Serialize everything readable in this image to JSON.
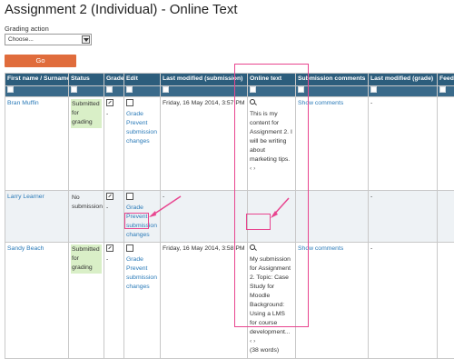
{
  "page": {
    "title": "Assignment 2 (Individual) - Online Text",
    "grading_action_label": "Grading action",
    "grading_action_value": "Choose...",
    "go_label": "Go"
  },
  "table": {
    "headers": {
      "name": "First name / Surname",
      "status": "Status",
      "grade": "Grade",
      "edit": "Edit",
      "last_modified": "Last modified (submission)",
      "online_text": "Online text",
      "comments": "Submission comments",
      "last_modified_grade": "Last modified (grade)",
      "feedback": "Feedb"
    },
    "rows": [
      {
        "name": "Bran Muffin",
        "status": "Submitted for grading",
        "grade_dash": "-",
        "edit_grade": "Grade",
        "edit_prevent": "Prevent submission changes",
        "modified": "Friday, 16 May 2014, 3:57 PM",
        "online_text": "This is my content for Assignment 2. I will be writing about marketing tips.",
        "comments": "Show comments",
        "modified_grade": "-",
        "scroll": "‹ ›"
      },
      {
        "name": "Larry Learner",
        "status": "No submission",
        "grade_dash": "-",
        "edit_grade": "Grade",
        "edit_prevent": "Prevent submission changes",
        "modified": "-",
        "online_text": "",
        "comments": "",
        "modified_grade": "-"
      },
      {
        "name": "Sandy Beach",
        "status": "Submitted for grading",
        "grade_dash": "-",
        "edit_grade": "Grade",
        "edit_prevent": "Prevent submission changes",
        "modified": "Friday, 16 May 2014, 3:58 PM",
        "online_text": "My submission for Assignment 2. Topic: Case Study for Moodle Background: Using a LMS for course development...",
        "comments": "Show comments",
        "modified_grade": "-",
        "scroll": "‹ ›",
        "word_count": "(38 words)"
      }
    ]
  },
  "colors": {
    "header_bg": "#2c5d7c",
    "go_button": "#e06c3c",
    "submitted_bg": "#d9efc7",
    "highlight": "#e8458f",
    "link": "#2a7ab8"
  }
}
